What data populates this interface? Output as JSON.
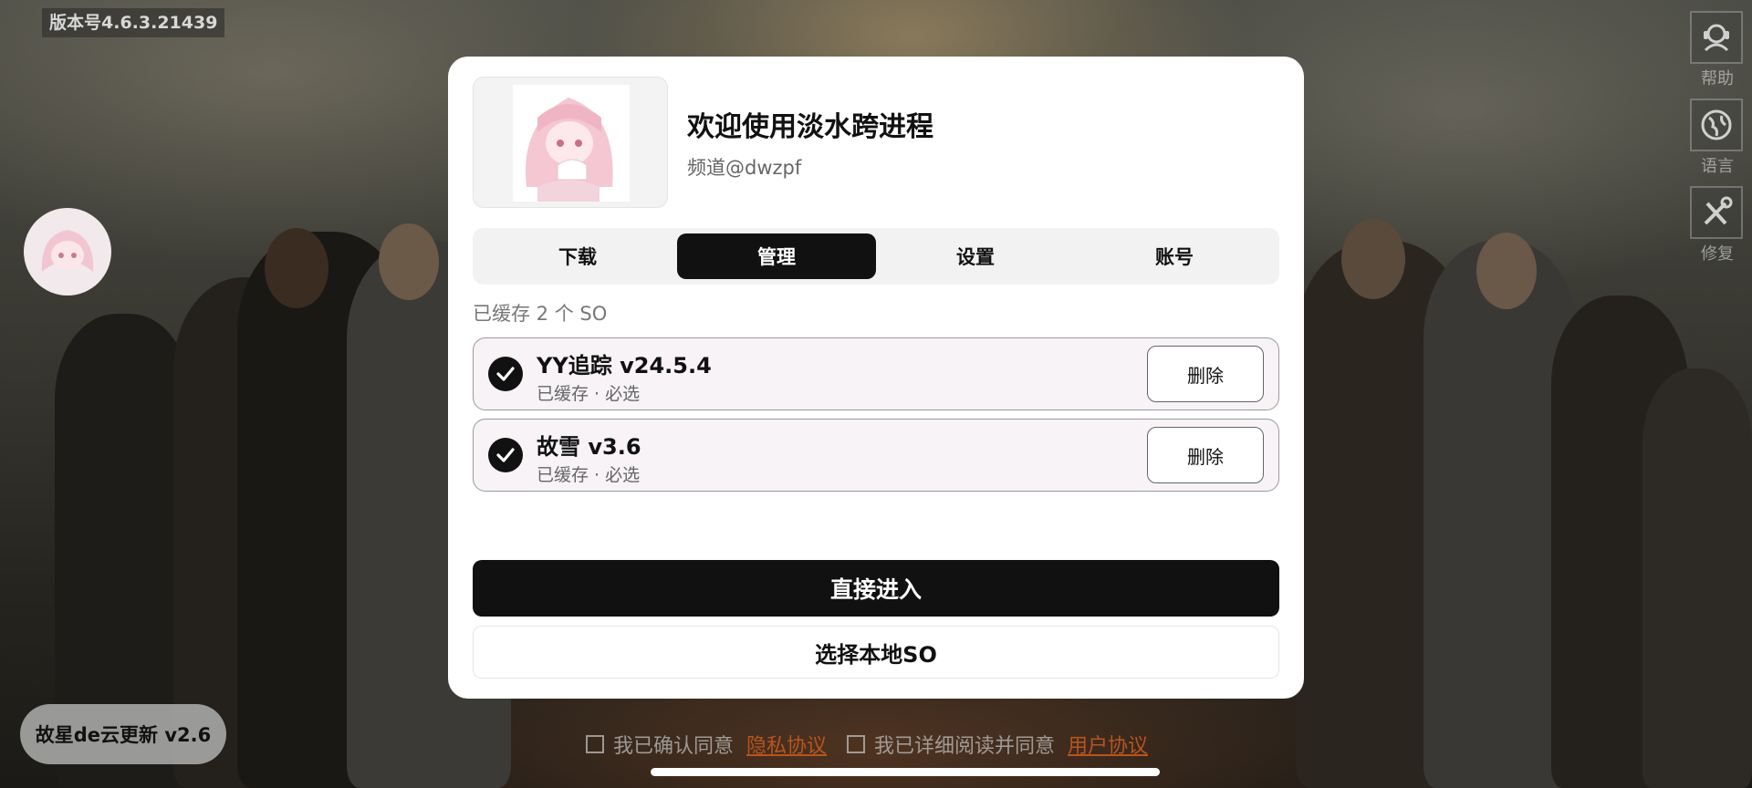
{
  "app": {
    "version_label": "版本号4.6.3.21439"
  },
  "side_menu": [
    {
      "label": "帮助",
      "icon": "help-icon"
    },
    {
      "label": "语言",
      "icon": "globe-icon"
    },
    {
      "label": "修复",
      "icon": "tools-icon"
    }
  ],
  "dialog": {
    "title": "欢迎使用淡水跨进程",
    "subtitle": "频道@dwzpf",
    "tabs": [
      {
        "label": "下载",
        "active": false
      },
      {
        "label": "管理",
        "active": true
      },
      {
        "label": "设置",
        "active": false
      },
      {
        "label": "账号",
        "active": false
      }
    ],
    "cache_count": "已缓存 2 个 SO",
    "items": [
      {
        "name": "YY追踪  v24.5.4",
        "meta": "已缓存 · 必选",
        "delete_label": "删除",
        "checked": true
      },
      {
        "name": "故雪  v3.6",
        "meta": "已缓存 · 必选",
        "delete_label": "删除",
        "checked": true
      }
    ],
    "primary_button": "直接进入",
    "secondary_button": "选择本地SO"
  },
  "update_pill": "故星de云更新 v2.6",
  "agreements": {
    "privacy_prefix": "我已确认同意",
    "privacy_link": "隐私协议",
    "user_prefix": "我已详细阅读并同意",
    "user_link": "用户协议"
  },
  "colors": {
    "accent": "#111111",
    "link": "#b8551e",
    "item_bg": "#f7f3f6"
  }
}
